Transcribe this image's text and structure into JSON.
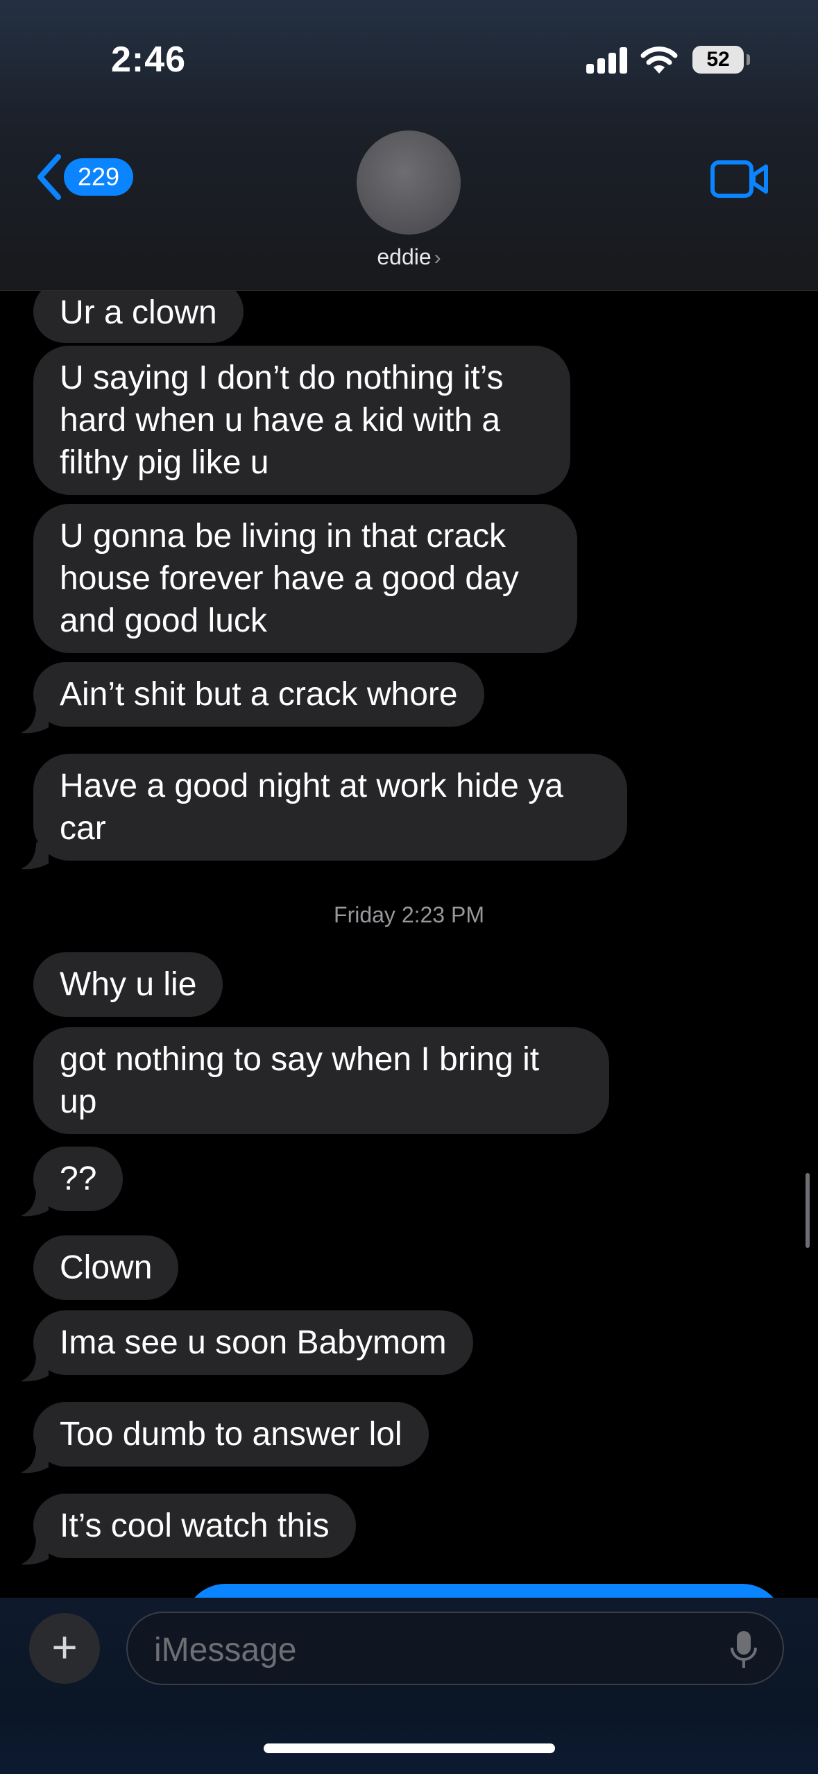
{
  "status_bar": {
    "time": "2:46",
    "battery": "52"
  },
  "header": {
    "back_count": "229",
    "contact_name": "eddie",
    "contact_arrow": "›"
  },
  "messages": [
    "Ur a clown",
    "U saying I don’t do nothing it’s hard when u have a kid with a filthy pig like u",
    "U gonna be living in that crack house forever have a good day and good luck",
    "Ain’t shit but a crack whore",
    "Have a good night at work hide ya car",
    "Why u lie",
    "got nothing to say when I bring it up",
    "??",
    "Clown",
    "Ima see u soon Babymom",
    "Too dumb to answer lol",
    "It’s cool watch this"
  ],
  "timestamp": "Friday 2:23 PM",
  "composer": {
    "placeholder": "iMessage",
    "plus": "+"
  },
  "colors": {
    "accent": "#0a84ff",
    "bubble_incoming": "#262628"
  }
}
